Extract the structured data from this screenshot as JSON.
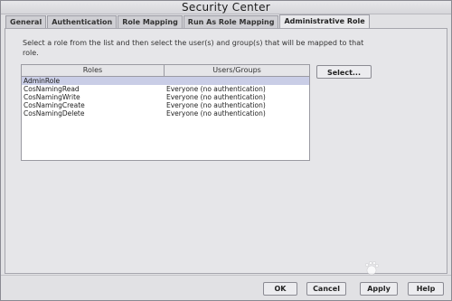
{
  "window": {
    "title": "Security Center"
  },
  "tabs": [
    {
      "label": "General",
      "active": false
    },
    {
      "label": "Authentication",
      "active": false
    },
    {
      "label": "Role Mapping",
      "active": false
    },
    {
      "label": "Run As Role Mapping",
      "active": false
    },
    {
      "label": "Administrative Role",
      "active": true
    }
  ],
  "instruction": "Select a role from the list and then select the user(s) and group(s) that will be mapped to that role.",
  "table": {
    "headers": {
      "roles": "Roles",
      "users": "Users/Groups"
    },
    "rows": [
      {
        "role": "AdminRole",
        "users": "",
        "selected": true
      },
      {
        "role": "CosNamingRead",
        "users": "Everyone (no authentication)",
        "selected": false
      },
      {
        "role": "CosNamingWrite",
        "users": "Everyone (no authentication)",
        "selected": false
      },
      {
        "role": "CosNamingCreate",
        "users": "Everyone (no authentication)",
        "selected": false
      },
      {
        "role": "CosNamingDelete",
        "users": "Everyone (no authentication)",
        "selected": false
      }
    ]
  },
  "buttons": {
    "select": "Select...",
    "ok": "OK",
    "cancel": "Cancel",
    "apply": "Apply",
    "help": "Help"
  },
  "colors": {
    "window_bg": "#e1e1e4",
    "selected_row": "#c9cde6"
  }
}
